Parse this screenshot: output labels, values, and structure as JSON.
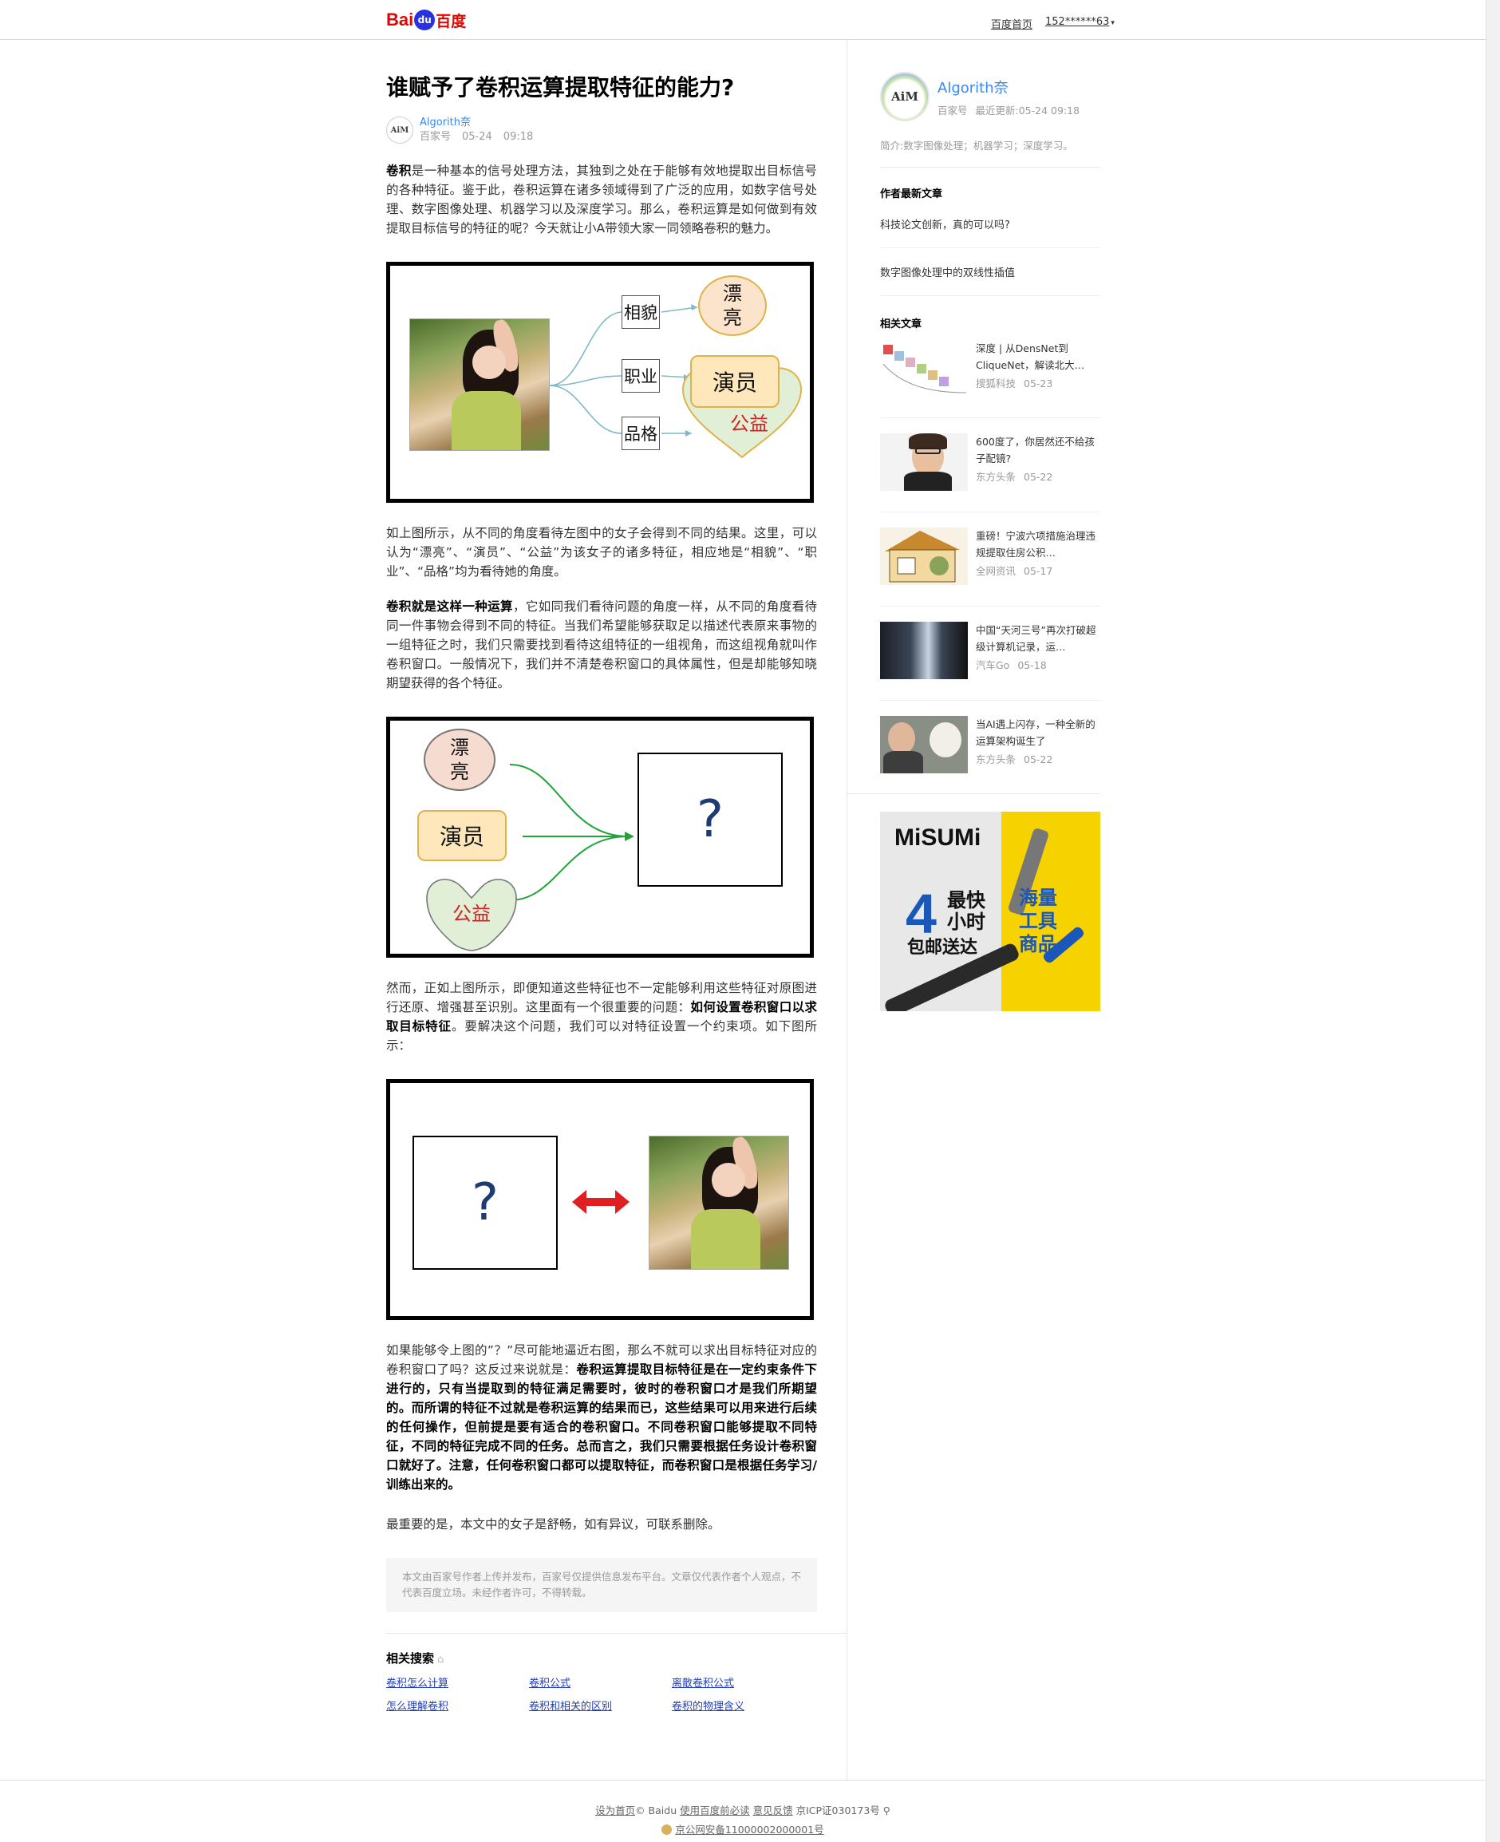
{
  "header": {
    "logo_bai": "Bai",
    "logo_paw": "du",
    "logo_cn": "百度",
    "home_link": "百度首页",
    "user": "152******63"
  },
  "article": {
    "title": "谁赋予了卷积运算提取特征的能力?",
    "author": "Algorith奈",
    "avatar_text": "AiM",
    "source": "百家号",
    "date": "05-24",
    "time": "09:18",
    "p1_strong": "卷积",
    "p1_rest": "是一种基本的信号处理方法，其独到之处在于能够有效地提取出目标信号的各种特征。鉴于此，卷积运算在诸多领域得到了广泛的应用，如数字信号处理、数字图像处理、机器学习以及深度学习。那么，卷积运算是如何做到有效提取目标信号的特征的呢？今天就让小A带领大家一同领略卷积的魅力。",
    "fig1": {
      "labels": [
        "相貌",
        "职业",
        "品格"
      ],
      "beauty": "漂\n亮",
      "actor": "演员",
      "charity": "公益"
    },
    "p2": "如上图所示，从不同的角度看待左图中的女子会得到不同的结果。这里，可以认为“漂亮”、“演员”、“公益”为该女子的诸多特征，相应地是“相貌”、“职业”、“品格”均为看待她的角度。",
    "p3_strong": "卷积就是这样一种运算",
    "p3_rest": "，它如同我们看待问题的角度一样，从不同的角度看待同一件事物会得到不同的特征。当我们希望能够获取足以描述代表原来事物的一组特征之时，我们只需要找到看待这组特征的一组视角，而这组视角就叫作卷积窗口。一般情况下，我们并不清楚卷积窗口的具体属性，但是却能够知晓期望获得的各个特征。",
    "fig2": {
      "beauty": "漂\n亮",
      "actor": "演员",
      "charity": "公益",
      "question": "?"
    },
    "p4_a": "然而，正如上图所示，即便知道这些特征也不一定能够利用这些特征对原图进行还原、增强甚至识别。这里面有一个很重要的问题：",
    "p4_strong": "如何设置卷积窗口以求取目标特征",
    "p4_b": "。要解决这个问题，我们可以对特征设置一个约束项。如下图所示：",
    "fig3": {
      "question": "?"
    },
    "p5_a": "如果能够令上图的”？”尽可能地逼近右图，那么不就可以求出目标特征对应的卷积窗口了吗？这反过来说就是：",
    "p5_strong": "卷积运算提取目标特征是在一定约束条件下进行的，只有当提取到的特征满足需要时，彼时的卷积窗口才是我们所期望的。而所谓的特征不过就是卷积运算的结果而已，这些结果可以用来进行后续的任何操作，但前提是要有适合的卷积窗口。不同卷积窗口能够提取不同特征，不同的特征完成不同的任务。总而言之，我们只需要根据任务设计卷积窗口就好了。注意，任何卷积窗口都可以提取特征，而卷积窗口是根据任务学习/训练出来的。",
    "p6": "最重要的是，本文中的女子是舒畅，如有异议，可联系删除。",
    "notice": "本文由百家号作者上传并发布，百家号仅提供信息发布平台。文章仅代表作者个人观点，不代表百度立场。未经作者许可，不得转载。"
  },
  "related_search": {
    "title": "相关搜索",
    "items": [
      "卷积怎么计算",
      "卷积公式",
      "离散卷积公式",
      "怎么理解卷积",
      "卷积和相关的区别",
      "卷积的物理含义"
    ]
  },
  "sidebar": {
    "author": "Algorith奈",
    "avatar_text": "AiM",
    "source": "百家号",
    "updated": "最近更新:05-24  09:18",
    "intro": "简介:数字图像处理；机器学习；深度学习。",
    "latest_title": "作者最新文章",
    "latest": [
      "科技论文创新，真的可以吗?",
      "数字图像处理中的双线性插值"
    ],
    "related_title": "相关文章",
    "related": [
      {
        "title": "深度 | 从DensNet到CliqueNet，解读北大…",
        "source": "搜狐科技",
        "date": "05-23"
      },
      {
        "title": "600度了，你居然还不给孩子配镜?",
        "source": "东方头条",
        "date": "05-22"
      },
      {
        "title": "重磅！宁波六项措施治理违规提取住房公积…",
        "source": "全网资讯",
        "date": "05-17"
      },
      {
        "title": "中国“天河三号”再次打破超级计算机记录，运…",
        "source": "汽车Go",
        "date": "05-18"
      },
      {
        "title": "当AI遇上闪存，一种全新的运算架构诞生了",
        "source": "东方头条",
        "date": "05-22"
      }
    ],
    "ad": {
      "brand": "MiSUMi",
      "big": "4",
      "line1": "最快\n小时",
      "line2": "包邮送达",
      "right": "海量工具商品"
    }
  },
  "footer": {
    "set_home": "设为首页",
    "copyright": "© Baidu",
    "must_know": "使用百度前必读",
    "feedback": "意见反馈",
    "icp": "京ICP证030173号",
    "police": "京公网安备11000002000001号"
  }
}
